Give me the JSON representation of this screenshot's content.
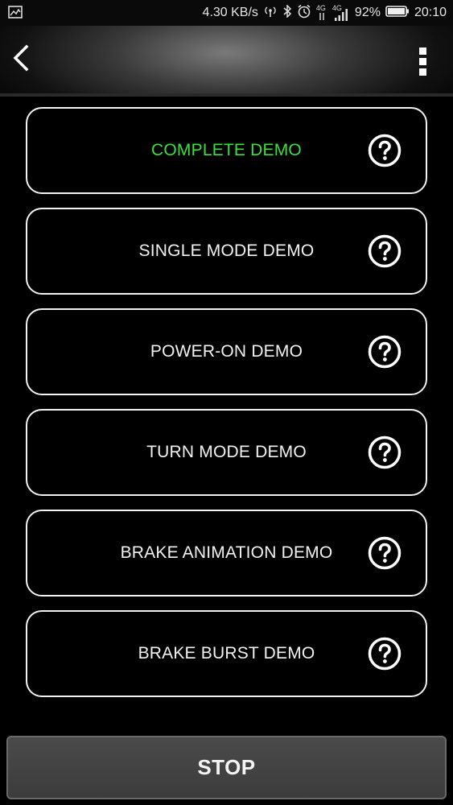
{
  "status_bar": {
    "network_speed": "4.30 KB/s",
    "network_type_1": "4G",
    "network_type_2": "4G",
    "battery": "92%",
    "time": "20:10"
  },
  "app_bar": {
    "back_icon": "chevron-left-icon",
    "menu_icon": "more-vert-icon"
  },
  "demos": [
    {
      "label": "COMPLETE DEMO",
      "active": true
    },
    {
      "label": "SINGLE MODE DEMO",
      "active": false
    },
    {
      "label": "POWER-ON DEMO",
      "active": false
    },
    {
      "label": "TURN MODE DEMO",
      "active": false
    },
    {
      "label": "BRAKE ANIMATION DEMO",
      "active": false
    },
    {
      "label": "BRAKE BURST DEMO",
      "active": false
    }
  ],
  "stop_button": {
    "label": "STOP"
  },
  "colors": {
    "active_text": "#3be03b",
    "text": "#f2f2f2",
    "background": "#000000"
  }
}
